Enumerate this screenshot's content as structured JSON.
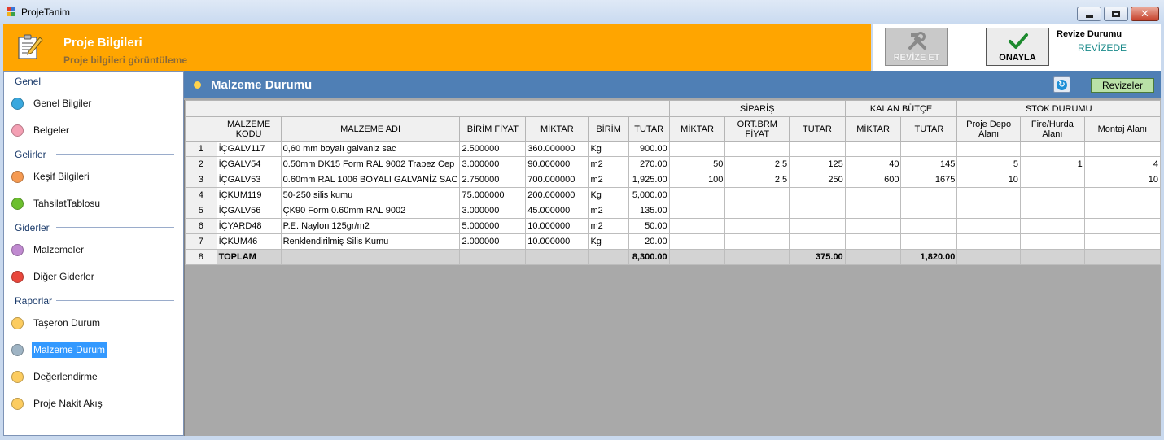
{
  "window": {
    "title": "ProjeTanim"
  },
  "header": {
    "title": "Proje Bilgileri",
    "subtitle": "Proje bilgileri görüntüleme",
    "revize_button": "REVİZE ET",
    "onayla_button": "ONAYLA",
    "revize_durumu_label": "Revize Durumu",
    "revize_durumu_value": "REVİZEDE"
  },
  "sidebar": {
    "groups": [
      "Genel",
      "Gelirler",
      "Giderler",
      "Raporlar"
    ],
    "items": [
      {
        "label": "Genel Bilgiler",
        "color": "#3aa8de"
      },
      {
        "label": "Belgeler",
        "color": "#f4a0b4"
      },
      {
        "label": "Keşif Bilgileri",
        "color": "#f59a52"
      },
      {
        "label": "TahsilatTablosu",
        "color": "#6cbf2e"
      },
      {
        "label": "Malzemeler",
        "color": "#c08ad0"
      },
      {
        "label": "Diğer Giderler",
        "color": "#e8473c"
      },
      {
        "label": "Taşeron Durum",
        "color": "#fccc60"
      },
      {
        "label": "Malzeme Durum",
        "color": "#9fb4c4"
      },
      {
        "label": "Değerlendirme",
        "color": "#fccc60"
      },
      {
        "label": "Proje Nakit Akış",
        "color": "#fccc60"
      }
    ],
    "active_item": "Malzeme Durum"
  },
  "panel": {
    "title": "Malzeme Durumu",
    "refresh_icon": "refresh-icon",
    "revizeler_button": "Revizeler"
  },
  "grid": {
    "group_headers": [
      "SİPARİŞ",
      "KALAN BÜTÇE",
      "STOK DURUMU"
    ],
    "columns": [
      "MALZEME KODU",
      "MALZEME ADI",
      "BİRİM FİYAT",
      "MİKTAR",
      "BİRİM",
      "TUTAR",
      "MİKTAR",
      "ORT.BRM FİYAT",
      "TUTAR",
      "MİKTAR",
      "TUTAR",
      "Proje Depo Alanı",
      "Fire/Hurda Alanı",
      "Montaj Alanı"
    ],
    "rows": [
      [
        "1",
        "İÇGALV117",
        "0,60 mm boyalı galvaniz sac",
        "2.500000",
        "360.000000",
        "Kg",
        "900.00",
        "",
        "",
        "",
        "",
        "",
        "",
        "",
        ""
      ],
      [
        "2",
        "İÇGALV54",
        "0.50mm DK15 Form RAL 9002 Trapez Cep",
        "3.000000",
        "90.000000",
        "m2",
        "270.00",
        "50",
        "2.5",
        "125",
        "40",
        "145",
        "5",
        "1",
        "4"
      ],
      [
        "3",
        "İÇGALV53",
        "0.60mm RAL 1006 BOYALI GALVANİZ SAC",
        "2.750000",
        "700.000000",
        "m2",
        "1,925.00",
        "100",
        "2.5",
        "250",
        "600",
        "1675",
        "10",
        "",
        "10"
      ],
      [
        "4",
        "İÇKUM119",
        "50-250 silis kumu",
        "75.000000",
        "200.000000",
        "Kg",
        "5,000.00",
        "",
        "",
        "",
        "",
        "",
        "",
        "",
        ""
      ],
      [
        "5",
        "İÇGALV56",
        "ÇK90 Form 0.60mm RAL 9002",
        "3.000000",
        "45.000000",
        "m2",
        "135.00",
        "",
        "",
        "",
        "",
        "",
        "",
        "",
        ""
      ],
      [
        "6",
        "İÇYARD48",
        "P.E. Naylon 125gr/m2",
        "5.000000",
        "10.000000",
        "m2",
        "50.00",
        "",
        "",
        "",
        "",
        "",
        "",
        "",
        ""
      ],
      [
        "7",
        "İÇKUM46",
        "Renklendirilmiş Silis Kumu",
        "2.000000",
        "10.000000",
        "Kg",
        "20.00",
        "",
        "",
        "",
        "",
        "",
        "",
        "",
        ""
      ]
    ],
    "total_row": [
      "8",
      "TOPLAM",
      "",
      "",
      "",
      "",
      "8,300.00",
      "",
      "",
      "375.00",
      "",
      "1,820.00",
      "",
      "",
      ""
    ]
  },
  "colors": {
    "header_orange": "#ffa500",
    "panel_blue": "#4f7fb5",
    "active_blue": "#3399ff"
  }
}
